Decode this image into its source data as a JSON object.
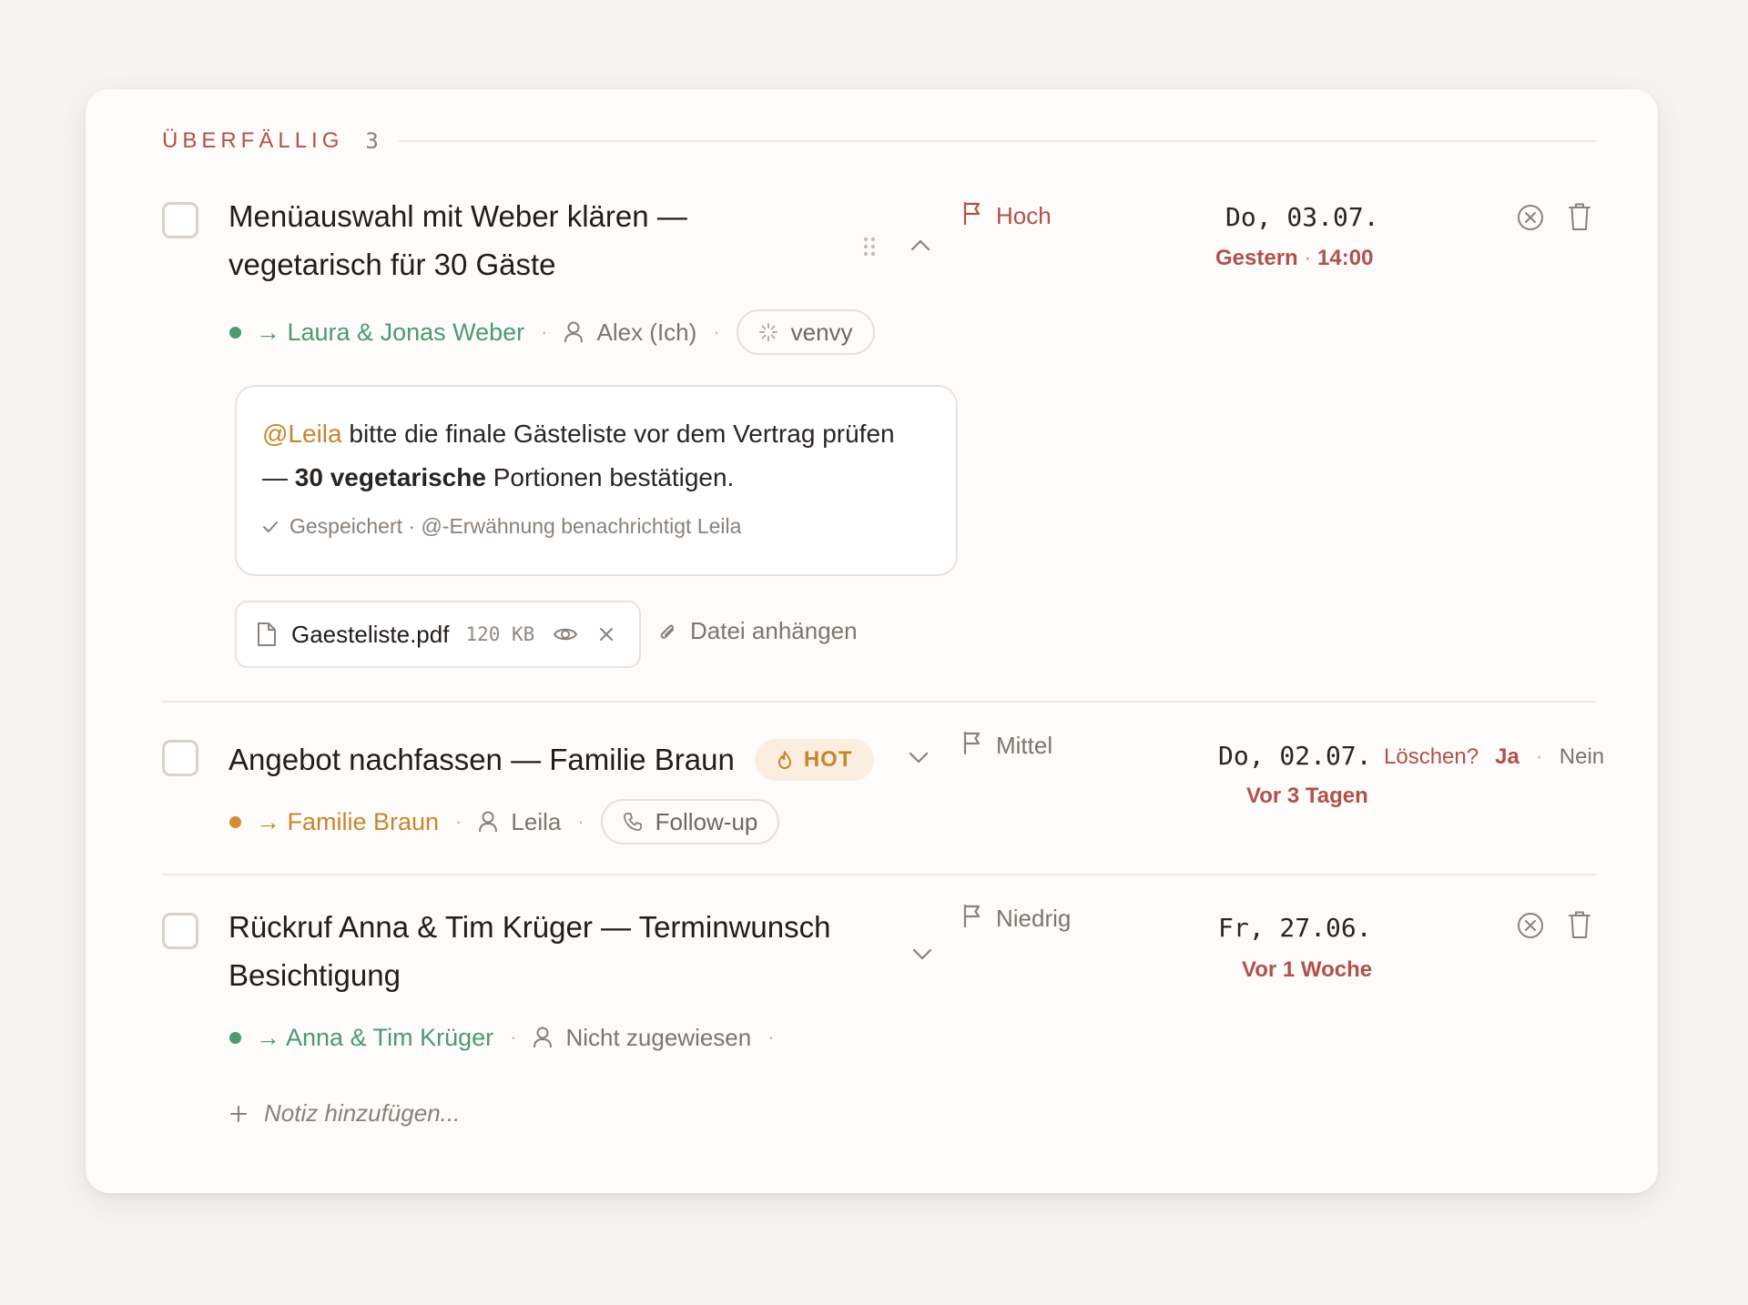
{
  "section": {
    "title": "ÜBERFÄLLIG",
    "count": "3"
  },
  "tasks": [
    {
      "title_line1": "Menüauswahl mit Weber klären —",
      "title_line2": "vegetarisch für 30 Gäste",
      "contact": "→ Laura & Jonas Weber",
      "assignee": "Alex (Ich)",
      "source": "venvy",
      "priority": "Hoch",
      "date": "Do, 03.07.",
      "relative_day": "Gestern",
      "relative_time": "14:00",
      "note": {
        "mention": "@Leila",
        "text_a": " bitte die finale Gästeliste vor dem Vertrag prüfen",
        "text_b": "— ",
        "bold": "30 vegetarische",
        "text_c": " Portionen bestätigen.",
        "status": "Gespeichert · @-Erwähnung benachrichtigt Leila"
      },
      "file": {
        "name": "Gaesteliste.pdf",
        "size": "120 KB"
      },
      "attach_label": "Datei anhängen",
      "colors": {
        "dot": "#4a9b72",
        "contact": "#4a9b72",
        "priority": "#b2514a"
      }
    },
    {
      "title": "Angebot nachfassen — Familie Braun",
      "tag": "HOT",
      "contact": "→ Familie Braun",
      "assignee": "Leila",
      "source": "Follow-up",
      "priority": "Mittel",
      "date": "Do, 02.07.",
      "relative": "Vor 3 Tagen",
      "confirm": {
        "question": "Löschen?",
        "yes": "Ja",
        "sep": "·",
        "no": "Nein"
      },
      "colors": {
        "dot": "#d48c2c",
        "contact": "#c8862a"
      }
    },
    {
      "title_line1": "Rückruf Anna & Tim Krüger — Terminwunsch",
      "title_line2": "Besichtigung",
      "contact": "→ Anna & Tim Krüger",
      "assignee": "Nicht zugewiesen",
      "priority": "Niedrig",
      "date": "Fr, 27.06.",
      "relative": "Vor 1 Woche",
      "add_note": "Notiz hinzufügen...",
      "colors": {
        "dot": "#4a9b72",
        "contact": "#4a9b72"
      }
    }
  ],
  "icons": [
    "flag-icon",
    "user-icon",
    "spinner-icon",
    "phone-icon",
    "flame-icon",
    "file-icon",
    "eye-icon",
    "close-icon",
    "paperclip-icon",
    "check-icon",
    "plus-icon",
    "chevron-up-icon",
    "chevron-down-icon",
    "drag-handle-icon",
    "circle-x-icon",
    "trash-icon"
  ]
}
